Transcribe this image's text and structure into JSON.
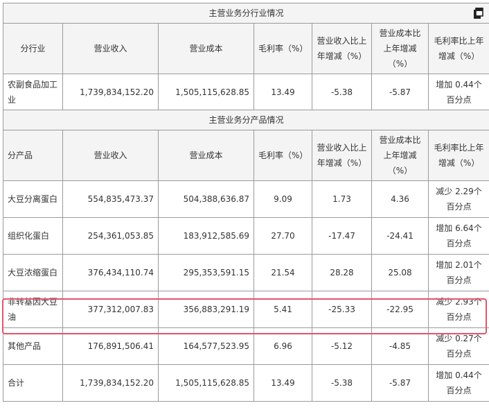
{
  "section1": {
    "title": "主营业务分行业情况"
  },
  "section2": {
    "title": "主营业务分产品情况"
  },
  "headers1": [
    "分行业",
    "营业收入",
    "营业成本",
    "毛利率（%）",
    "营业收入比上年增减（%）",
    "营业成本比上年增减（%）",
    "毛利率比上年增减（%）"
  ],
  "headers2": [
    "分产品",
    "营业收入",
    "营业成本",
    "毛利率（%）",
    "营业收入比上年增减（%）",
    "营业成本比上年增减（%）",
    "毛利率比上年增减（%）"
  ],
  "industry_rows": [
    [
      "农副食品加工业",
      "1,739,834,152.20",
      "1,505,115,628.85",
      "13.49",
      "-5.38",
      "-5.87",
      "增加 0.44个百分点"
    ]
  ],
  "product_rows": [
    [
      "大豆分离蛋白",
      "554,835,473.37",
      "504,388,636.87",
      "9.09",
      "1.73",
      "4.36",
      "减少 2.29个百分点"
    ],
    [
      "组织化蛋白",
      "254,361,053.85",
      "183,912,585.69",
      "27.70",
      "-17.47",
      "-24.41",
      "增加 6.64个百分点"
    ],
    [
      "大豆浓缩蛋白",
      "376,434,110.74",
      "295,353,591.15",
      "21.54",
      "28.28",
      "25.08",
      "增加 2.01个百分点"
    ],
    [
      "非转基因大豆油",
      "377,312,007.83",
      "356,883,291.19",
      "5.41",
      "-25.33",
      "-22.95",
      "减少 2.93个百分点"
    ],
    [
      "其他产品",
      "176,891,506.41",
      "164,577,523.95",
      "6.96",
      "-5.12",
      "-4.85",
      "减少 0.27个百分点"
    ],
    [
      "合计",
      "1,739,834,152.20",
      "1,505,115,628.85",
      "13.49",
      "-5.38",
      "-5.87",
      "增加 0.44个百分点"
    ]
  ],
  "colors": {
    "border": "#9a9a9a",
    "header_bg": "#f4f4f4",
    "highlight": "#e0556a"
  },
  "icons": {
    "copy": "copy-icon"
  }
}
